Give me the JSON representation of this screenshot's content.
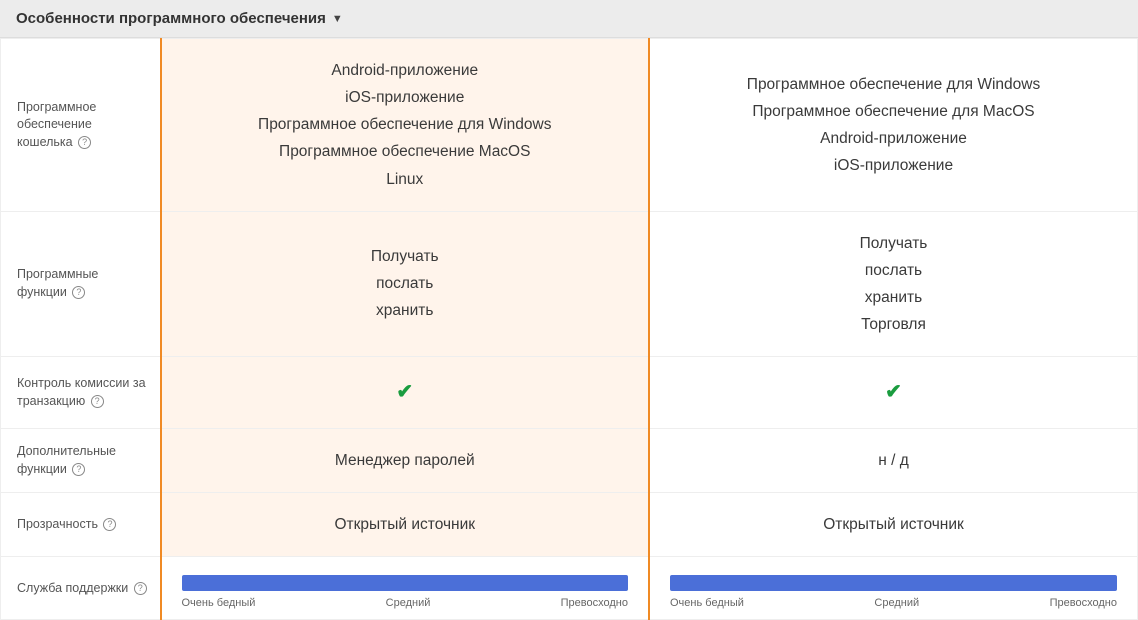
{
  "header": {
    "title": "Особенности программного обеспечения"
  },
  "rows": {
    "wallet_software": {
      "label": "Программное обеспечение кошелька",
      "left": [
        "Android-приложение",
        "iOS-приложение",
        "Программное обеспечение для Windows",
        "Программное обеспечение MacOS",
        "Linux"
      ],
      "right": [
        "Программное обеспечение для Windows",
        "Программное обеспечение для MacOS",
        "Android-приложение",
        "iOS-приложение"
      ]
    },
    "software_functions": {
      "label": "Программные функции",
      "left": [
        "Получать",
        "послать",
        "хранить"
      ],
      "right": [
        "Получать",
        "послать",
        "хранить",
        "Торговля"
      ]
    },
    "fee_control": {
      "label": "Контроль комиссии за транзакцию",
      "left_check": true,
      "right_check": true
    },
    "extra_functions": {
      "label": "Дополнительные функции",
      "left": "Менеджер паролей",
      "right": "н / д"
    },
    "transparency": {
      "label": "Прозрачность",
      "left": "Открытый источник",
      "right": "Открытый источник"
    },
    "support": {
      "label": "Служба поддержки",
      "scale": {
        "low": "Очень бедный",
        "mid": "Средний",
        "high": "Превосходно"
      }
    }
  }
}
